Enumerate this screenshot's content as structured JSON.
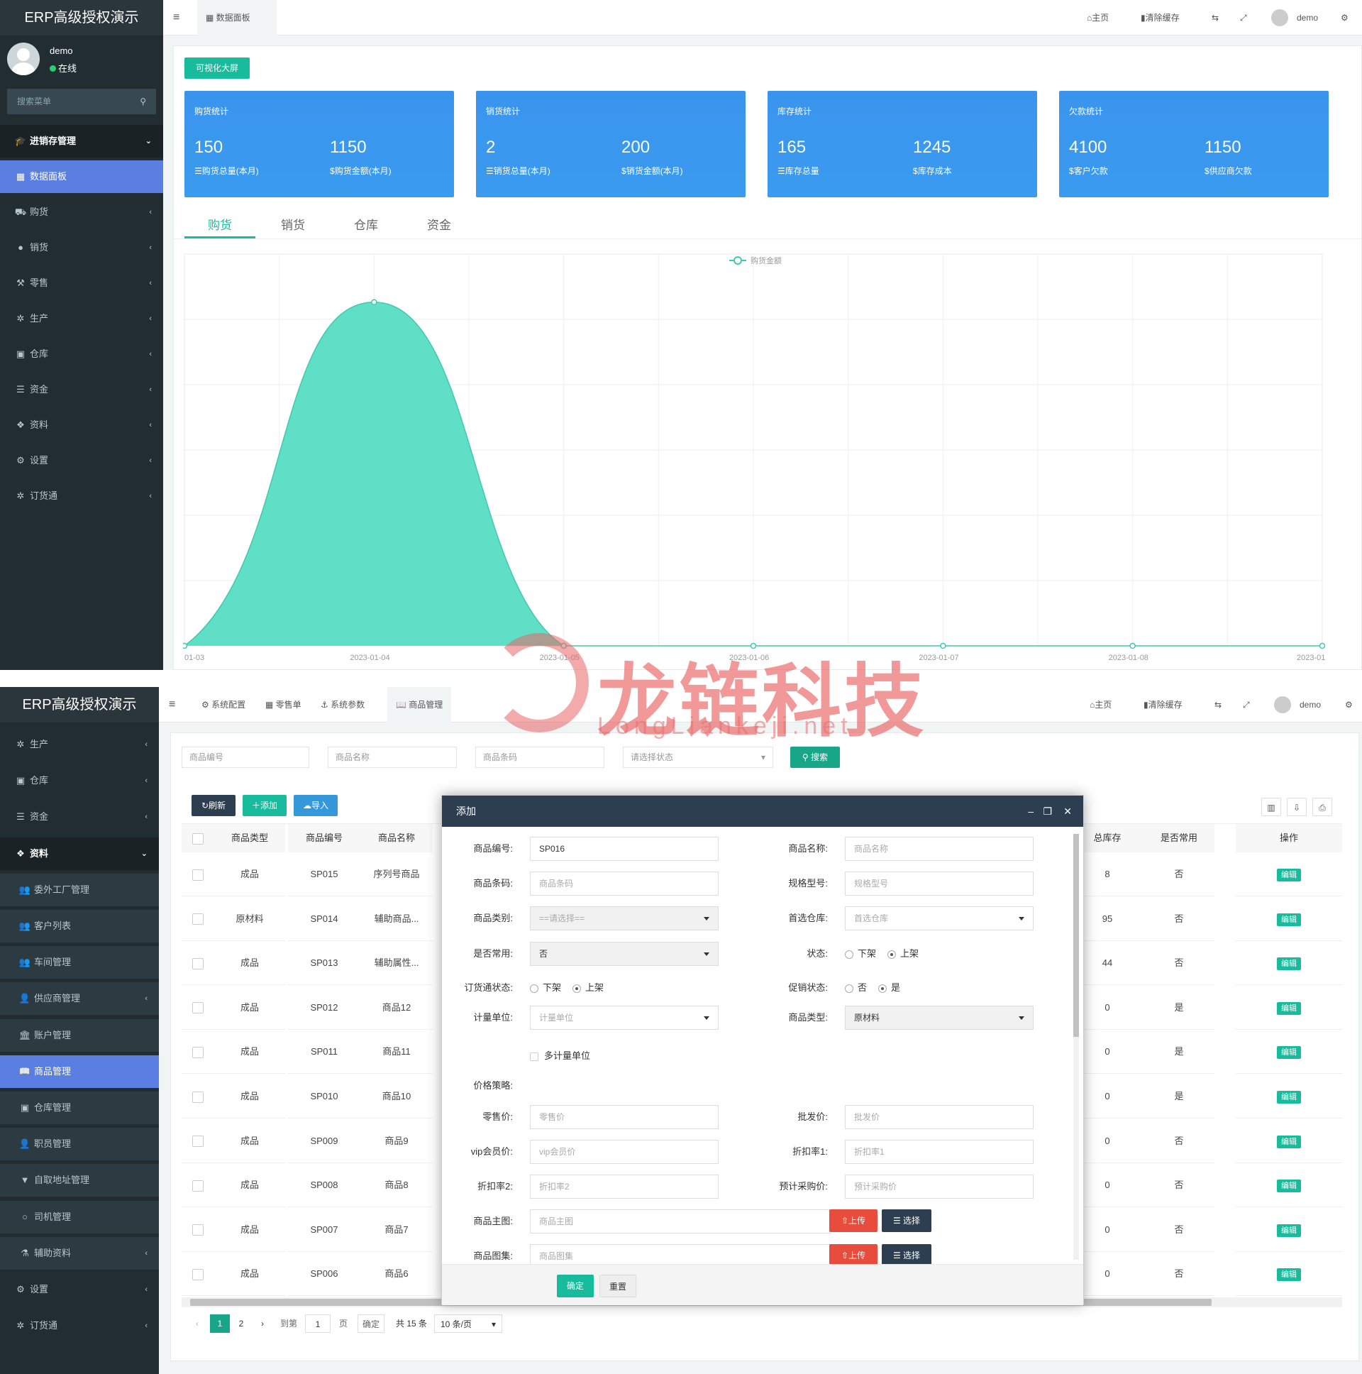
{
  "app": {
    "title": "ERP高级授权演示",
    "user_name": "demo",
    "user_status": "在线",
    "search_placeholder": "搜索菜单"
  },
  "screen1": {
    "menu_group": "进销存管理",
    "menu_items": [
      {
        "label": "数据面板",
        "icon": "chart-icon",
        "active": true
      },
      {
        "label": "购货",
        "icon": "cart-icon"
      },
      {
        "label": "销货",
        "icon": "bag-icon"
      },
      {
        "label": "零售",
        "icon": "hammer-icon"
      },
      {
        "label": "生产",
        "icon": "cogs-icon"
      },
      {
        "label": "仓库",
        "icon": "warehouse-icon"
      },
      {
        "label": "资金",
        "icon": "coins-icon"
      },
      {
        "label": "资料",
        "icon": "cubes-icon"
      },
      {
        "label": "设置",
        "icon": "gears-icon"
      },
      {
        "label": "订货通",
        "icon": "cogs-icon"
      }
    ],
    "header": {
      "tab": "数据面板",
      "home": "主页",
      "clear_cache": "清除缓存",
      "user": "demo"
    },
    "big_screen_button": "可视化大屏",
    "stats": [
      {
        "title": "购货统计",
        "v1": "150",
        "l1": "购货总量(本月)",
        "v2": "1150",
        "l2": "购货金额(本月)"
      },
      {
        "title": "销货统计",
        "v1": "2",
        "l1": "销货总量(本月)",
        "v2": "200",
        "l2": "销货金额(本月)"
      },
      {
        "title": "库存统计",
        "v1": "165",
        "l1": "库存总量",
        "v2": "1245",
        "l2": "库存成本"
      },
      {
        "title": "欠款统计",
        "v1": "4100",
        "l1": "客户欠款",
        "v2": "1150",
        "l2": "供应商欠款"
      }
    ],
    "chart_tabs": [
      "购货",
      "销货",
      "仓库",
      "资金"
    ],
    "chart_data": {
      "type": "area",
      "x": [
        "01-03",
        "2023-01-04",
        "2023-01-05",
        "2023-01-06",
        "2023-01-07",
        "2023-01-08",
        "2023-01"
      ],
      "series": [
        {
          "name": "购货金额",
          "values": [
            0,
            1150,
            0,
            0,
            0,
            0,
            0
          ],
          "color": "#5ddec6"
        }
      ],
      "legend": "top-center",
      "grid": true
    }
  },
  "screen2": {
    "menu_items": [
      {
        "label": "生产",
        "icon": "cogs-icon",
        "arrow": true
      },
      {
        "label": "仓库",
        "icon": "warehouse-icon",
        "arrow": true
      },
      {
        "label": "资金",
        "icon": "coins-icon",
        "arrow": true
      },
      {
        "label": "资料",
        "icon": "cubes-icon",
        "head": true
      },
      {
        "label": "委外工厂管理",
        "icon": "users-icon",
        "sub": true
      },
      {
        "label": "客户列表",
        "icon": "users-icon",
        "sub": true
      },
      {
        "label": "车间管理",
        "icon": "users-icon",
        "sub": true
      },
      {
        "label": "供应商管理",
        "icon": "user-icon",
        "sub": true,
        "arrow": true
      },
      {
        "label": "账户管理",
        "icon": "bank-icon",
        "sub": true
      },
      {
        "label": "商品管理",
        "icon": "book-icon",
        "sub": true,
        "active": true
      },
      {
        "label": "仓库管理",
        "icon": "warehouse-icon",
        "sub": true
      },
      {
        "label": "职员管理",
        "icon": "user-icon",
        "sub": true
      },
      {
        "label": "自取地址管理",
        "icon": "filter-icon",
        "sub": true
      },
      {
        "label": "司机管理",
        "icon": "circle-icon",
        "sub": true
      },
      {
        "label": "辅助资料",
        "icon": "flask-icon",
        "sub": true,
        "arrow": true
      },
      {
        "label": "设置",
        "icon": "gears-icon",
        "arrow": true
      },
      {
        "label": "订货通",
        "icon": "cogs-icon",
        "arrow": true
      }
    ],
    "header_tabs": [
      "系统配置",
      "零售单",
      "系统参数",
      "商品管理"
    ],
    "header": {
      "home": "主页",
      "clear_cache": "清除缓存",
      "user": "demo"
    },
    "filters": {
      "code": "商品编号",
      "name": "商品名称",
      "barcode": "商品条码",
      "status": "请选择状态",
      "search": "搜索"
    },
    "toolbar": {
      "refresh": "刷新",
      "add": "添加",
      "import": "导入"
    },
    "columns_left": [
      "商品类型",
      "商品编号",
      "商品名称"
    ],
    "columns_right": [
      "总库存",
      "是否常用",
      "操作"
    ],
    "rows": [
      {
        "type": "成品",
        "code": "SP015",
        "name": "序列号商品",
        "stock": "8",
        "common": "否"
      },
      {
        "type": "原材料",
        "code": "SP014",
        "name": "辅助商品...",
        "stock": "95",
        "common": "否"
      },
      {
        "type": "成品",
        "code": "SP013",
        "name": "辅助属性...",
        "stock": "44",
        "common": "否"
      },
      {
        "type": "成品",
        "code": "SP012",
        "name": "商品12",
        "stock": "0",
        "common": "是"
      },
      {
        "type": "成品",
        "code": "SP011",
        "name": "商品11",
        "stock": "0",
        "common": "是"
      },
      {
        "type": "成品",
        "code": "SP010",
        "name": "商品10",
        "stock": "0",
        "common": "是"
      },
      {
        "type": "成品",
        "code": "SP009",
        "name": "商品9",
        "stock": "0",
        "common": "否"
      },
      {
        "type": "成品",
        "code": "SP008",
        "name": "商品8",
        "stock": "0",
        "common": "否"
      },
      {
        "type": "成品",
        "code": "SP007",
        "name": "商品7",
        "stock": "0",
        "common": "否"
      },
      {
        "type": "成品",
        "code": "SP006",
        "name": "商品6",
        "stock": "0",
        "common": "否"
      }
    ],
    "edit_label": "编辑",
    "pager": {
      "p1": "1",
      "p2": "2",
      "goto": "到第",
      "page_value": "1",
      "page_unit": "页",
      "confirm": "确定",
      "total": "共 15 条",
      "per_page": "10 条/页"
    },
    "modal": {
      "title": "添加",
      "code_label": "商品编号:",
      "code_value": "SP016",
      "name_label": "商品名称:",
      "name_ph": "商品名称",
      "barcode_label": "商品条码:",
      "barcode_ph": "商品条码",
      "spec_label": "规格型号:",
      "spec_ph": "规格型号",
      "cat_label": "商品类别:",
      "cat_value": "==请选择==",
      "wh_label": "首选仓库:",
      "wh_value": "首选仓库",
      "common_label": "是否常用:",
      "common_value": "否",
      "status_label": "状态:",
      "off": "下架",
      "on": "上架",
      "order_label": "订货通状态:",
      "promo_label": "促销状态:",
      "no": "否",
      "yes": "是",
      "unit_label": "计量单位:",
      "unit_value": "计量单位",
      "ptype_label": "商品类型:",
      "ptype_value": "原材料",
      "multi_unit": "多计量单位",
      "price_label": "价格策略:",
      "retail_label": "零售价:",
      "retail_ph": "零售价",
      "wholesale_label": "批发价:",
      "wholesale_ph": "批发价",
      "vip_label": "vip会员价:",
      "vip_ph": "vip会员价",
      "d1_label": "折扣率1:",
      "d1_ph": "折扣率1",
      "d2_label": "折扣率2:",
      "d2_ph": "折扣率2",
      "est_label": "预计采购价:",
      "est_ph": "预计采购价",
      "img_label": "商品主图:",
      "img_ph": "商品主图",
      "gallery_label": "商品图集:",
      "gallery_ph": "商品图集",
      "upload": "上传",
      "choose": "选择",
      "ok": "确定",
      "reset": "重置"
    }
  },
  "watermark": {
    "cn": "龙链科技",
    "en": "LongLiankeji.net"
  },
  "colors": {
    "sidebar": "#222d32",
    "accent_green": "#18bc9c",
    "stat_blue": "#3a94ed",
    "active_menu": "#5a7fe0",
    "danger": "#e74c3c",
    "dark_btn": "#2c3e50"
  }
}
